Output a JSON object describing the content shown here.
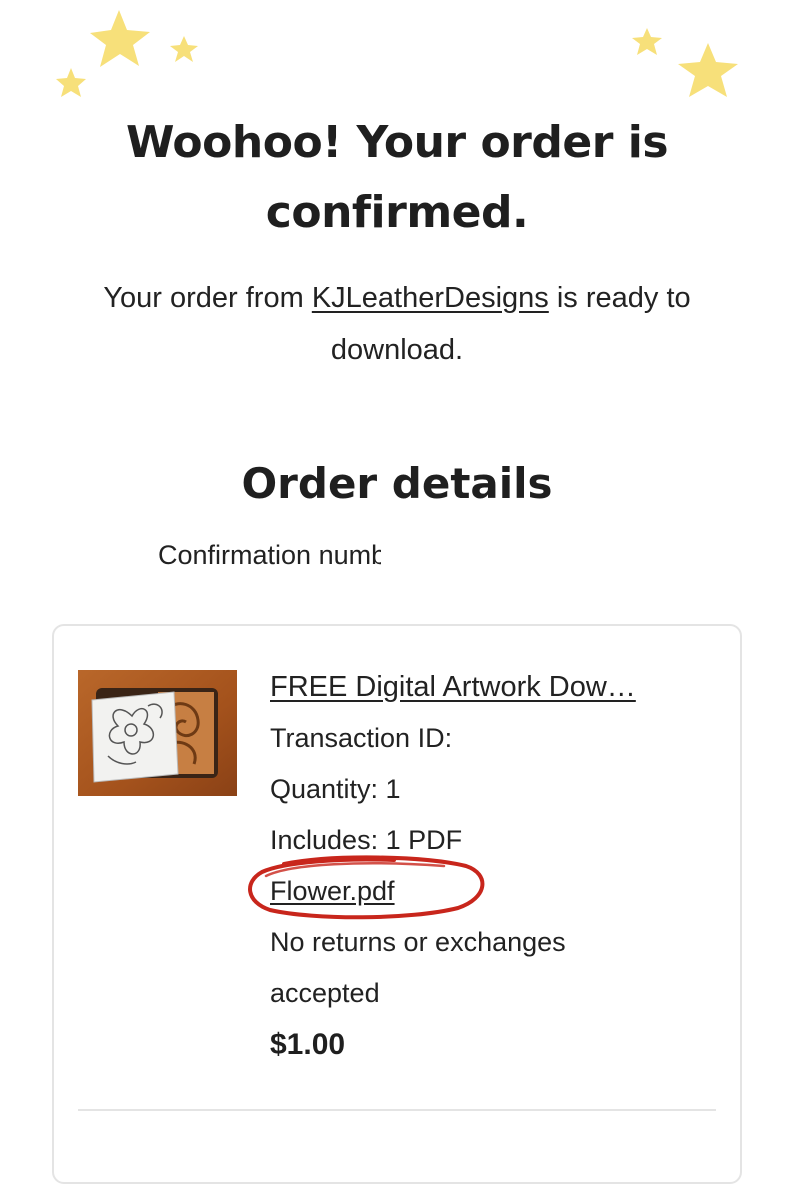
{
  "header": {
    "headline": "Woohoo! Your order is confirmed.",
    "sub_prefix": "Your order from ",
    "shop_name": "KJLeatherDesigns",
    "sub_suffix": " is ready to download."
  },
  "order": {
    "section_title": "Order details",
    "confirmation_label": "Confirmation numbe",
    "item": {
      "title": "FREE Digital Artwork Dow…",
      "transaction_label": "Transaction ID: ",
      "quantity": "Quantity: 1",
      "includes": "Includes: 1 PDF",
      "file_name": "Flower.pdf",
      "returns_line1": "No returns or exchanges",
      "returns_line2": "accepted",
      "price": "$1.00"
    }
  },
  "colors": {
    "star": "#f7e07a",
    "annotation": "#c8261c",
    "card_border": "#e4e4e4"
  },
  "icons": [
    "star-icon"
  ]
}
